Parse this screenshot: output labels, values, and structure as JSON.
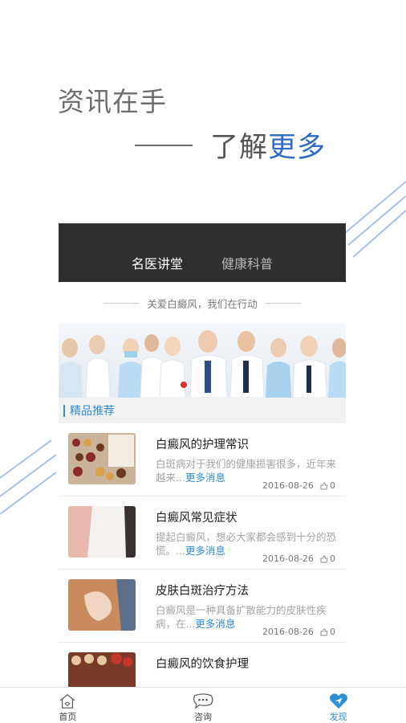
{
  "hero": {
    "headline": "资讯在手",
    "subline_prefix": "了解",
    "subline_highlight": "更多"
  },
  "card": {
    "tabs": [
      {
        "label": "名医讲堂",
        "active": true
      },
      {
        "label": "健康科普",
        "active": false
      }
    ],
    "slogan": "关爱白癜风，我们在行动",
    "section_title": "精品推荐",
    "news": [
      {
        "title": "白癜风的护理常识",
        "desc": "白斑病对于我们的健康损害很多，近年来越来...",
        "more": "更多消息",
        "date": "2016-08-26",
        "count": "0"
      },
      {
        "title": "白癜风常见症状",
        "desc": "提起白癜风，想必大家都会感到十分的恐慌。...",
        "more": "更多消息",
        "date": "2016-08-26",
        "count": "0"
      },
      {
        "title": "皮肤白斑治疗方法",
        "desc": "白癜风是一种具备扩散能力的皮肤性疾病，在...",
        "more": "更多消息",
        "date": "2016-08-26",
        "count": "0"
      },
      {
        "title": "白癜风的饮食护理",
        "desc": "",
        "more": "",
        "date": "",
        "count": ""
      }
    ]
  },
  "tabbar": {
    "items": [
      {
        "label": "首页",
        "icon": "home-icon",
        "active": false
      },
      {
        "label": "咨询",
        "icon": "chat-icon",
        "active": false
      },
      {
        "label": "发现",
        "icon": "discover-heart-icon",
        "active": true
      }
    ]
  },
  "colors": {
    "accent": "#2f8ed8",
    "highlight": "#2f6bc9",
    "dark_header": "#2f2f2f"
  }
}
